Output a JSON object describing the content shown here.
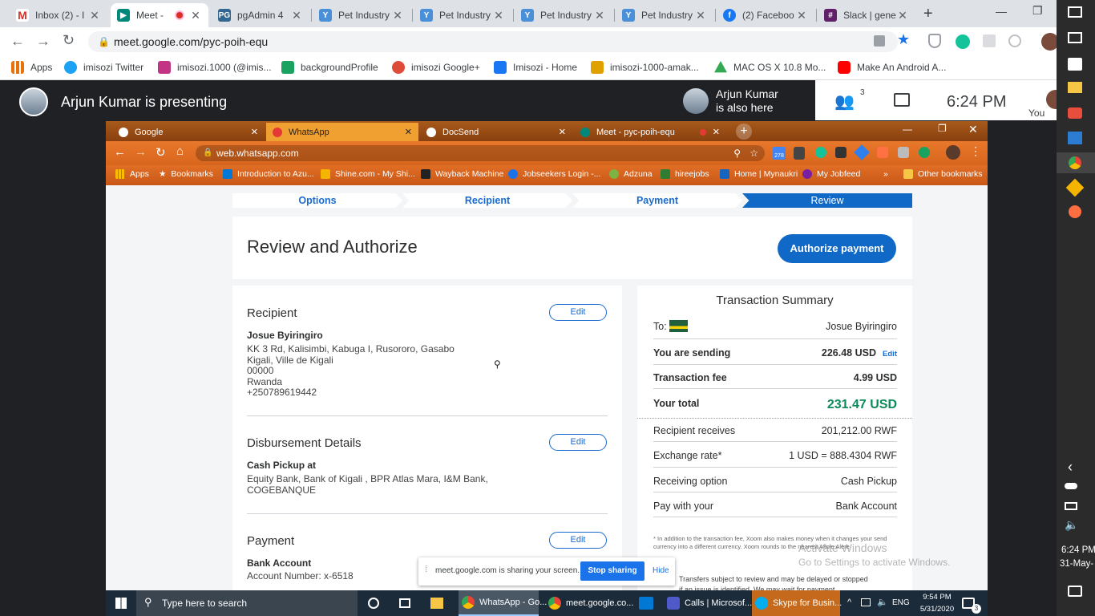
{
  "outer_browser": {
    "tabs": [
      {
        "title": "Inbox (2) - I",
        "icon": "gmail-icon",
        "color": "#d93025"
      },
      {
        "title": "Meet - ",
        "icon": "meet-icon",
        "color": "#00897b"
      },
      {
        "title": "pgAdmin 4",
        "icon": "pgadmin-icon",
        "color": "#336791"
      },
      {
        "title": "Pet Industry",
        "icon": "doc-icon",
        "color": "#4a90d9"
      },
      {
        "title": "Pet Industry",
        "icon": "doc-icon",
        "color": "#4a90d9"
      },
      {
        "title": "Pet Industry",
        "icon": "doc-icon",
        "color": "#4a90d9"
      },
      {
        "title": "Pet Industry",
        "icon": "doc-icon",
        "color": "#4a90d9"
      },
      {
        "title": "(2) Faceboo",
        "icon": "facebook-icon",
        "color": "#1877f2"
      },
      {
        "title": "Slack | gene",
        "icon": "slack-icon",
        "color": "#611f69"
      }
    ],
    "url": "meet.google.com/pyc-poih-equ",
    "bookmarks": [
      {
        "label": "Apps",
        "icon": "apps-icon",
        "color": "#e8710a"
      },
      {
        "label": "imisozi Twitter",
        "icon": "twitter-icon",
        "color": "#1da1f2"
      },
      {
        "label": "imisozi.1000 (@imis...",
        "icon": "instagram-icon",
        "color": "#c13584"
      },
      {
        "label": "backgroundProfile",
        "icon": "px-icon",
        "color": "#1aa260"
      },
      {
        "label": "imisozi Google+",
        "icon": "gplus-icon",
        "color": "#dd4b39"
      },
      {
        "label": "Imisozi - Home",
        "icon": "facebook-icon",
        "color": "#1877f2"
      },
      {
        "label": "imisozi-1000-amak...",
        "icon": "bike-icon",
        "color": "#e0a000"
      },
      {
        "label": "MAC OS X 10.8 Mo...",
        "icon": "drive-icon",
        "color": "#34a853"
      },
      {
        "label": "Make An Android A...",
        "icon": "youtube-icon",
        "color": "#ff0000"
      }
    ]
  },
  "meet": {
    "presenting": "Arjun Kumar is presenting",
    "also_here_line1": "Arjun Kumar",
    "also_here_line2": "is also here",
    "participant_count": "3",
    "time": "6:24 PM",
    "you_label": "You"
  },
  "inner_browser": {
    "tabs": [
      {
        "title": "Google",
        "color": "#4285f4"
      },
      {
        "title": "WhatsApp",
        "color": "#e53935"
      },
      {
        "title": "DocSend",
        "color": "#1a73e8"
      },
      {
        "title": "Meet - pyc-poih-equ",
        "color": "#00897b"
      }
    ],
    "url": "web.whatsapp.com",
    "ext_badge": "278",
    "bookmarks": [
      {
        "label": "Apps",
        "color": "#fbbc04"
      },
      {
        "label": "Bookmarks",
        "color": "#ffffff"
      },
      {
        "label": "Introduction to Azu...",
        "color": "#0078d4"
      },
      {
        "label": "Shine.com - My Shi...",
        "color": "#f4b400"
      },
      {
        "label": "Wayback Machine",
        "color": "#333333"
      },
      {
        "label": "Jobseekers Login -...",
        "color": "#1a73e8"
      },
      {
        "label": "Adzuna",
        "color": "#7cb342"
      },
      {
        "label": "hireejobs",
        "color": "#2e7d32"
      },
      {
        "label": "Home | Mynaukri",
        "color": "#1565c0"
      },
      {
        "label": "My Jobfeed",
        "color": "#7b1fa2"
      }
    ],
    "more": "»",
    "other_bookmarks": "Other bookmarks"
  },
  "steps": [
    "Options",
    "Recipient",
    "Payment",
    "Review"
  ],
  "review": {
    "title": "Review and Authorize",
    "authorize_label": "Authorize payment"
  },
  "recipient": {
    "heading": "Recipient",
    "edit": "Edit",
    "name": "Josue Byiringiro",
    "lines": [
      "KK 3 Rd, Kalisimbi, Kabuga I, Rusororo, Gasabo",
      "Kigali, Ville de Kigali",
      "00000",
      "Rwanda",
      "+250789619442"
    ]
  },
  "disbursement": {
    "heading": "Disbursement Details",
    "edit": "Edit",
    "method": "Cash Pickup at",
    "lines": [
      "Equity Bank, Bank of Kigali , BPR Atlas Mara, I&M Bank,",
      "COGEBANQUE"
    ]
  },
  "payment": {
    "heading": "Payment",
    "edit": "Edit",
    "method": "Bank Account",
    "account": "Account Number: x-6518"
  },
  "summary": {
    "title": "Transaction Summary",
    "to_label": "To:",
    "to_name": "Josue Byiringiro",
    "sending_label": "You are sending",
    "sending_value": "226.48  USD",
    "sending_edit": "Edit",
    "fee_label": "Transaction fee",
    "fee_value": "4.99  USD",
    "total_label": "Your total",
    "total_value": "231.47  USD",
    "receives_label": "Recipient receives",
    "receives_value": "201,212.00  RWF",
    "rate_label": "Exchange rate*",
    "rate_value": "1 USD = 888.4304 RWF",
    "option_label": "Receiving option",
    "option_value": "Cash Pickup",
    "pay_label": "Pay with your",
    "pay_value": "Bank Account",
    "footnote": "* In addition to the transaction fee, Xoom also makes money when it changes your send currency into a different currency. Xoom rounds to the nearest Aflole Alere",
    "transfers_note": "Transfers subject to review and may be delayed or stopped if an issue is identified. We may wait for payment"
  },
  "watermark": {
    "line1": "Activate Windows",
    "line2": "Go to Settings to activate Windows."
  },
  "share_bar": {
    "text": "meet.google.com is sharing your screen.",
    "stop": "Stop sharing",
    "hide": "Hide"
  },
  "taskbar": {
    "search_placeholder": "Type here to search",
    "items": [
      "WhatsApp - Go...",
      "meet.google.co...",
      "Calls | Microsof...",
      "Skype for Busin..."
    ],
    "lang": "ENG",
    "time": "9:54 PM",
    "date": "5/31/2020",
    "notif_count": "3"
  },
  "side": {
    "time": "6:24 PM",
    "date": "31-May-"
  }
}
